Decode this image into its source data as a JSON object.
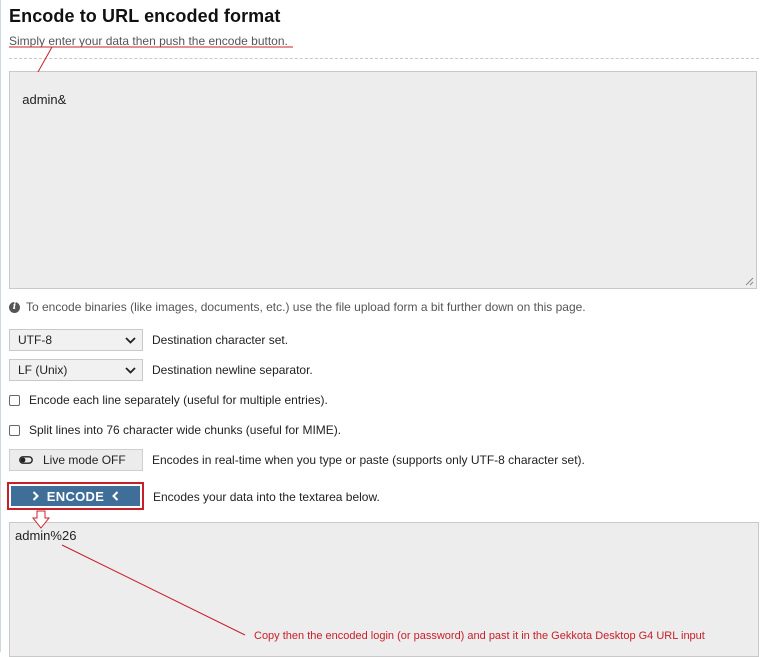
{
  "header": {
    "title": "Encode to URL encoded format",
    "subtitle": "Simply enter your data then push the encode button."
  },
  "input": {
    "value": "admin&"
  },
  "info": {
    "text": "To encode binaries (like images, documents, etc.) use the file upload form a bit further down on this page."
  },
  "charset": {
    "selected": "UTF-8",
    "label": "Destination character set."
  },
  "newline": {
    "selected": "LF (Unix)",
    "label": "Destination newline separator."
  },
  "options": {
    "each_line": "Encode each line separately (useful for multiple entries).",
    "split_lines": "Split lines into 76 character wide chunks (useful for MIME)."
  },
  "live_mode": {
    "label": "Live mode OFF",
    "description": "Encodes in real-time when you type or paste (supports only UTF-8 character set)."
  },
  "encode": {
    "label": "ENCODE",
    "description": "Encodes your data into the textarea below."
  },
  "output": {
    "value": "admin%26"
  },
  "annotation": {
    "text": "Copy then the encoded login (or password) and past it in the Gekkota Desktop G4 URL input"
  },
  "colors": {
    "accent": "#3f6e98",
    "annotation": "#c8202a"
  }
}
